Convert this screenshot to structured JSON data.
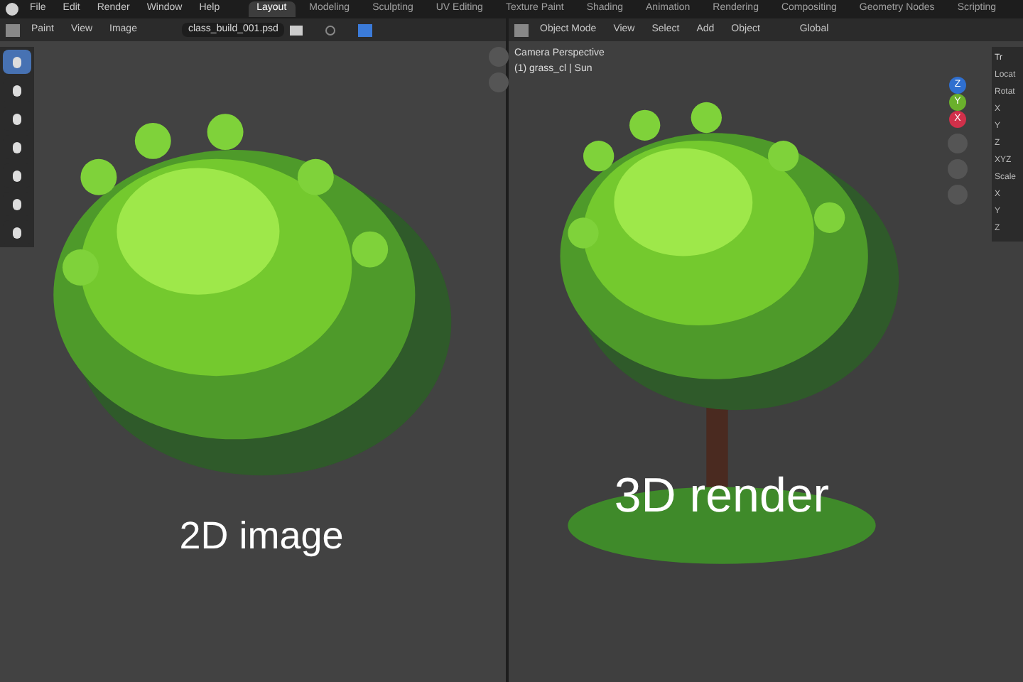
{
  "menu": [
    "File",
    "Edit",
    "Render",
    "Window",
    "Help"
  ],
  "workspaces": [
    {
      "label": "Layout",
      "selected": true
    },
    {
      "label": "Modeling",
      "selected": false
    },
    {
      "label": "Sculpting",
      "selected": false
    },
    {
      "label": "UV Editing",
      "selected": false
    },
    {
      "label": "Texture Paint",
      "selected": false
    },
    {
      "label": "Shading",
      "selected": false
    },
    {
      "label": "Animation",
      "selected": false
    },
    {
      "label": "Rendering",
      "selected": false
    },
    {
      "label": "Compositing",
      "selected": false
    },
    {
      "label": "Geometry Nodes",
      "selected": false
    },
    {
      "label": "Scripting",
      "selected": false
    }
  ],
  "image_editor": {
    "mode": "Paint",
    "menus": [
      "View",
      "Image"
    ],
    "image_name": "class_build_001.psd",
    "tools": [
      {
        "selected": true
      },
      {
        "selected": false
      },
      {
        "selected": false
      },
      {
        "selected": false
      },
      {
        "selected": false
      },
      {
        "selected": false
      },
      {
        "selected": false
      }
    ],
    "caption": "2D image"
  },
  "viewport": {
    "mode": "Object Mode",
    "menus": [
      "View",
      "Select",
      "Add",
      "Object"
    ],
    "orientation": "Global",
    "overlay_title": "Camera Perspective",
    "overlay_info": "(1) grass_cl | Sun",
    "gizmo_axes": [
      "Z",
      "Y",
      "X"
    ],
    "caption": "3D render"
  },
  "sidebar": {
    "tab": "Tr",
    "labels": [
      "Locat",
      "Rotat",
      "X",
      "Y",
      "Z",
      "XYZ",
      "Scale",
      "X",
      "Y",
      "Z"
    ]
  }
}
